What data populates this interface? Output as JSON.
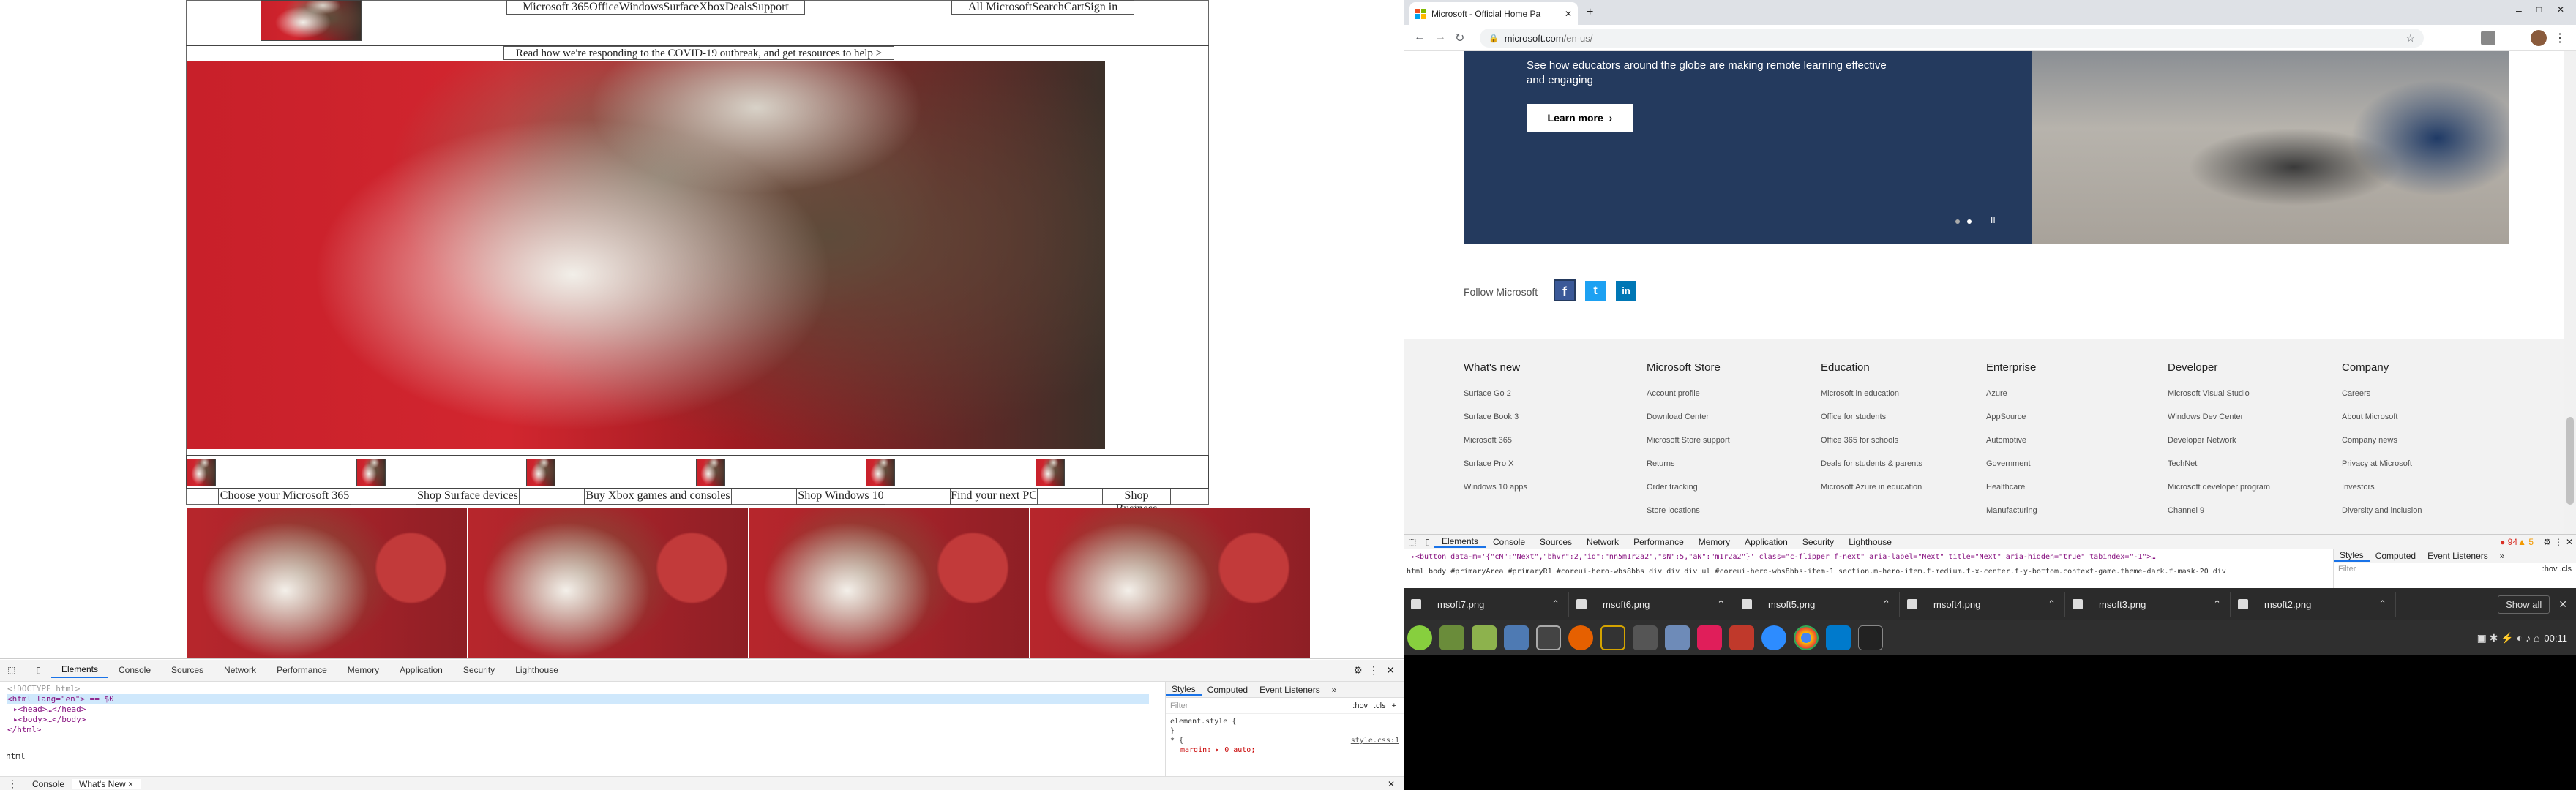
{
  "left": {
    "nav": {
      "items": "Microsoft 365OfficeWindowsSurfaceXboxDealsSupport",
      "right": "All MicrosoftSearchCartSign in"
    },
    "covid": "Read how we're responding to the COVID-19 outbreak, and get resources to help >",
    "links": [
      "Choose your Microsoft 365",
      "Shop Surface devices",
      "Buy Xbox games and consoles",
      "Shop Windows 10",
      "Find your next PC",
      "Shop Business"
    ],
    "devtools": {
      "tabs": [
        "Elements",
        "Console",
        "Sources",
        "Network",
        "Performance",
        "Memory",
        "Application",
        "Security",
        "Lighthouse"
      ],
      "code": [
        "<!DOCTYPE html>",
        "<html lang=\"en\"> == $0",
        "▸<head>…</head>",
        "▸<body>…</body>",
        "</html>"
      ],
      "breadcrumb": "html",
      "styles_tabs": [
        "Styles",
        "Computed",
        "Event Listeners",
        "»"
      ],
      "filter_placeholder": "Filter",
      "hov": ":hov",
      "cls": ".cls",
      "plus": "+",
      "element_style": "element.style {",
      "close_brace": "}",
      "rule_open": "* {",
      "rule_source": "style.css:1",
      "rule_prop": "margin: ▸ 0 auto;",
      "drawer_tabs": [
        "Console",
        "What's New ×"
      ]
    }
  },
  "browser": {
    "tab_title": "Microsoft - Official Home Pa",
    "url_host": "microsoft.com",
    "url_path": "/en-us/",
    "hero": {
      "text": "See how educators around the globe are making remote learning effective and engaging",
      "button": "Learn more",
      "pause": "II"
    },
    "follow": "Follow Microsoft",
    "social": [
      "f",
      "t",
      "in"
    ],
    "footer": [
      {
        "title": "What's new",
        "items": [
          "Surface Go 2",
          "Surface Book 3",
          "Microsoft 365",
          "Surface Pro X",
          "Windows 10 apps"
        ]
      },
      {
        "title": "Microsoft Store",
        "items": [
          "Account profile",
          "Download Center",
          "Microsoft Store support",
          "Returns",
          "Order tracking",
          "Store locations"
        ]
      },
      {
        "title": "Education",
        "items": [
          "Microsoft in education",
          "Office for students",
          "Office 365 for schools",
          "Deals for students & parents",
          "Microsoft Azure in education"
        ]
      },
      {
        "title": "Enterprise",
        "items": [
          "Azure",
          "AppSource",
          "Automotive",
          "Government",
          "Healthcare",
          "Manufacturing"
        ]
      },
      {
        "title": "Developer",
        "items": [
          "Microsoft Visual Studio",
          "Windows Dev Center",
          "Developer Network",
          "TechNet",
          "Microsoft developer program",
          "Channel 9"
        ]
      },
      {
        "title": "Company",
        "items": [
          "Careers",
          "About Microsoft",
          "Company news",
          "Privacy at Microsoft",
          "Investors",
          "Diversity and inclusion"
        ]
      }
    ],
    "devtools": {
      "tabs": [
        "Elements",
        "Console",
        "Sources",
        "Network",
        "Performance",
        "Memory",
        "Application",
        "Security",
        "Lighthouse"
      ],
      "errors": "94",
      "warnings": "5",
      "code_line1": "▸<button data-m='{\"cN\":\"Next\",\"bhvr\":2,\"id\":\"nn5m1r2a2\",\"sN\":5,\"aN\":\"m1r2a2\"}' class=\"c-flipper f-next\" aria-label=\"Next\" title=\"Next\" aria-hidden=\"true\" tabindex=\"-1\">…",
      "breadcrumb": "html  body  #primaryArea  #primaryR1  #coreui-hero-wbs8bbs  div  div  div  ul  #coreui-hero-wbs8bbs-item-1  section.m-hero-item.f-medium.f-x-center.f-y-bottom.context-game.theme-dark.f-mask-20  div",
      "styles_tabs": [
        "Styles",
        "Computed",
        "Event Listeners",
        "»"
      ],
      "filter": "Filter",
      "hov": ":hov .cls"
    },
    "downloads": [
      "msoft7.png",
      "msoft6.png",
      "msoft5.png",
      "msoft4.png",
      "msoft3.png",
      "msoft2.png"
    ],
    "show_all": "Show all",
    "clock": "00:11"
  }
}
